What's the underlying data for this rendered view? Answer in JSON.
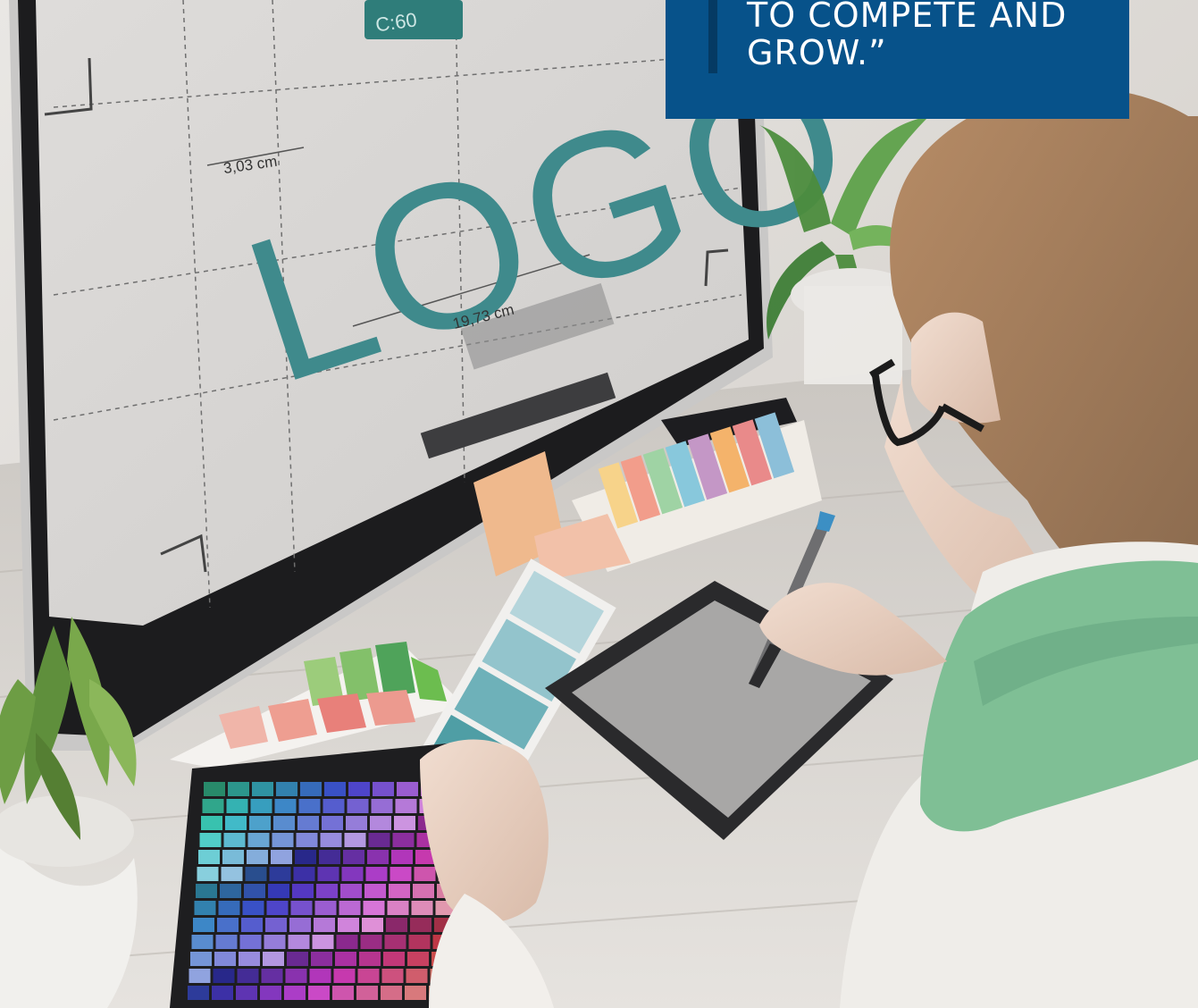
{
  "quote": {
    "text": "TO COMPETE AND\nGROW.”"
  },
  "screen": {
    "logo_word": "LOGO",
    "dimension_height": "3,03 cm",
    "dimension_width": "19,73 cm",
    "tag_label": "C:60"
  },
  "colors": {
    "quote_background": "#07528a",
    "logo_teal": "#3f8a8c"
  }
}
